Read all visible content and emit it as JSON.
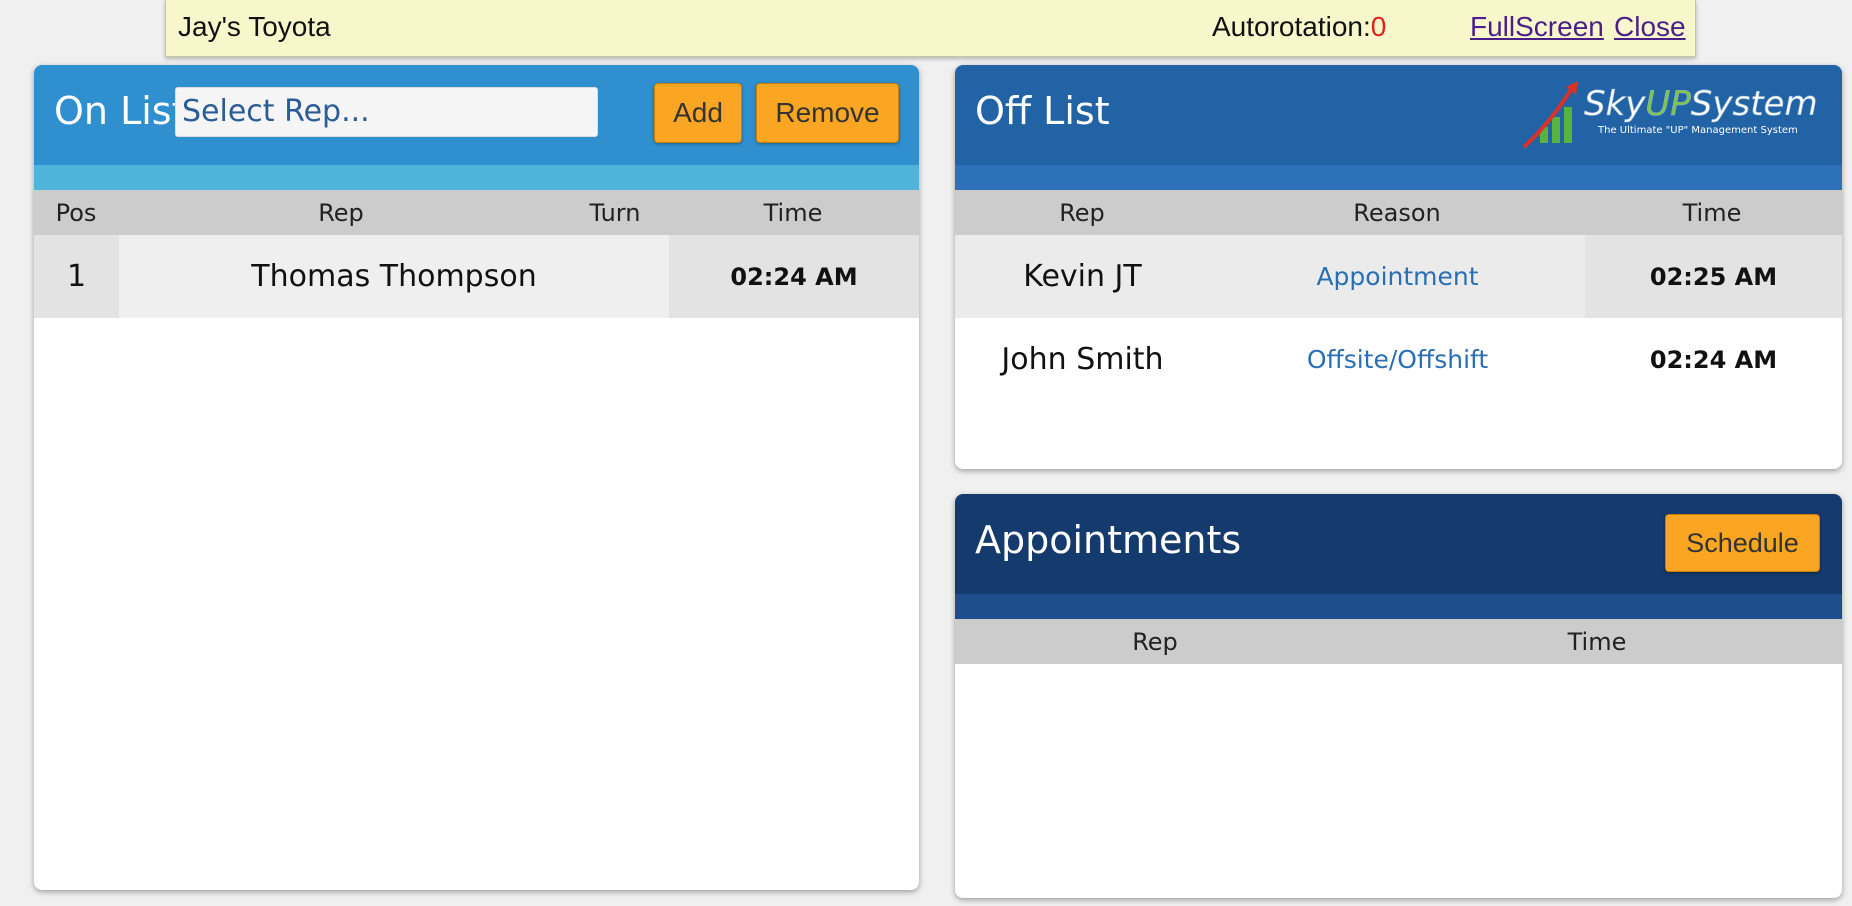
{
  "topbar": {
    "dealer": "Jay's Toyota",
    "autorotation_label": "Autorotation:",
    "autorotation_value": "0",
    "fullscreen_label": "FullScreen",
    "close_label": "Close"
  },
  "on_list": {
    "title": "On List",
    "select_placeholder": "Select Rep...",
    "add_label": "Add",
    "remove_label": "Remove",
    "columns": [
      "Pos",
      "Rep",
      "Turn",
      "Time"
    ],
    "rows": [
      {
        "pos": "1",
        "rep": "Thomas Thompson",
        "turn": "",
        "time": "02:24 AM"
      }
    ]
  },
  "off_list": {
    "title": "Off List",
    "logo": {
      "brand": "SkyUPSystem",
      "tagline": "The Ultimate \"UP\" Management System"
    },
    "columns": [
      "Rep",
      "Reason",
      "Time"
    ],
    "rows": [
      {
        "rep": "Kevin JT",
        "reason": "Appointment",
        "time": "02:25 AM"
      },
      {
        "rep": "John Smith",
        "reason": "Offsite/Offshift",
        "time": "02:24 AM"
      }
    ]
  },
  "appointments": {
    "title": "Appointments",
    "schedule_label": "Schedule",
    "columns": [
      "Rep",
      "Time"
    ]
  },
  "colors": {
    "accent_button": "#fba622",
    "on_list_header": "#2f8fcf",
    "off_list_header": "#2163a5",
    "appointments_header": "#143a6e",
    "autorotation_value": "#e0221c",
    "reason_link": "#2a6fb5"
  }
}
